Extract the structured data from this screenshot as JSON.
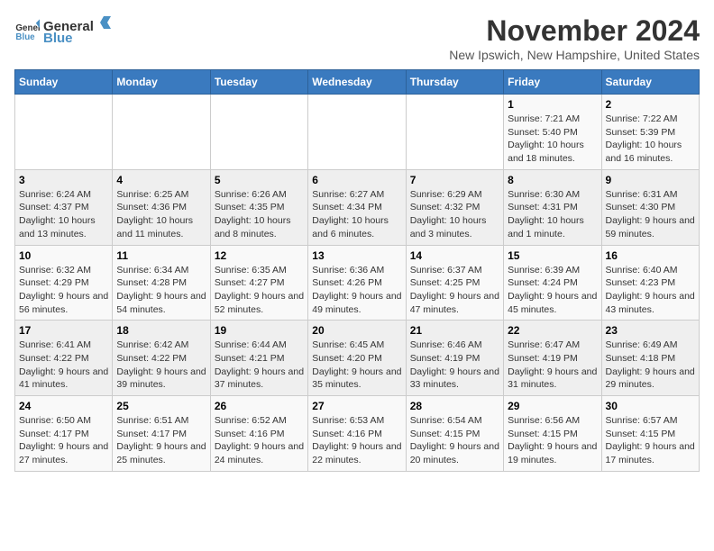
{
  "logo": {
    "text_general": "General",
    "text_blue": "Blue"
  },
  "title": "November 2024",
  "subtitle": "New Ipswich, New Hampshire, United States",
  "days_of_week": [
    "Sunday",
    "Monday",
    "Tuesday",
    "Wednesday",
    "Thursday",
    "Friday",
    "Saturday"
  ],
  "weeks": [
    [
      {
        "day": "",
        "info": ""
      },
      {
        "day": "",
        "info": ""
      },
      {
        "day": "",
        "info": ""
      },
      {
        "day": "",
        "info": ""
      },
      {
        "day": "",
        "info": ""
      },
      {
        "day": "1",
        "info": "Sunrise: 7:21 AM\nSunset: 5:40 PM\nDaylight: 10 hours and 18 minutes."
      },
      {
        "day": "2",
        "info": "Sunrise: 7:22 AM\nSunset: 5:39 PM\nDaylight: 10 hours and 16 minutes."
      }
    ],
    [
      {
        "day": "3",
        "info": "Sunrise: 6:24 AM\nSunset: 4:37 PM\nDaylight: 10 hours and 13 minutes."
      },
      {
        "day": "4",
        "info": "Sunrise: 6:25 AM\nSunset: 4:36 PM\nDaylight: 10 hours and 11 minutes."
      },
      {
        "day": "5",
        "info": "Sunrise: 6:26 AM\nSunset: 4:35 PM\nDaylight: 10 hours and 8 minutes."
      },
      {
        "day": "6",
        "info": "Sunrise: 6:27 AM\nSunset: 4:34 PM\nDaylight: 10 hours and 6 minutes."
      },
      {
        "day": "7",
        "info": "Sunrise: 6:29 AM\nSunset: 4:32 PM\nDaylight: 10 hours and 3 minutes."
      },
      {
        "day": "8",
        "info": "Sunrise: 6:30 AM\nSunset: 4:31 PM\nDaylight: 10 hours and 1 minute."
      },
      {
        "day": "9",
        "info": "Sunrise: 6:31 AM\nSunset: 4:30 PM\nDaylight: 9 hours and 59 minutes."
      }
    ],
    [
      {
        "day": "10",
        "info": "Sunrise: 6:32 AM\nSunset: 4:29 PM\nDaylight: 9 hours and 56 minutes."
      },
      {
        "day": "11",
        "info": "Sunrise: 6:34 AM\nSunset: 4:28 PM\nDaylight: 9 hours and 54 minutes."
      },
      {
        "day": "12",
        "info": "Sunrise: 6:35 AM\nSunset: 4:27 PM\nDaylight: 9 hours and 52 minutes."
      },
      {
        "day": "13",
        "info": "Sunrise: 6:36 AM\nSunset: 4:26 PM\nDaylight: 9 hours and 49 minutes."
      },
      {
        "day": "14",
        "info": "Sunrise: 6:37 AM\nSunset: 4:25 PM\nDaylight: 9 hours and 47 minutes."
      },
      {
        "day": "15",
        "info": "Sunrise: 6:39 AM\nSunset: 4:24 PM\nDaylight: 9 hours and 45 minutes."
      },
      {
        "day": "16",
        "info": "Sunrise: 6:40 AM\nSunset: 4:23 PM\nDaylight: 9 hours and 43 minutes."
      }
    ],
    [
      {
        "day": "17",
        "info": "Sunrise: 6:41 AM\nSunset: 4:22 PM\nDaylight: 9 hours and 41 minutes."
      },
      {
        "day": "18",
        "info": "Sunrise: 6:42 AM\nSunset: 4:22 PM\nDaylight: 9 hours and 39 minutes."
      },
      {
        "day": "19",
        "info": "Sunrise: 6:44 AM\nSunset: 4:21 PM\nDaylight: 9 hours and 37 minutes."
      },
      {
        "day": "20",
        "info": "Sunrise: 6:45 AM\nSunset: 4:20 PM\nDaylight: 9 hours and 35 minutes."
      },
      {
        "day": "21",
        "info": "Sunrise: 6:46 AM\nSunset: 4:19 PM\nDaylight: 9 hours and 33 minutes."
      },
      {
        "day": "22",
        "info": "Sunrise: 6:47 AM\nSunset: 4:19 PM\nDaylight: 9 hours and 31 minutes."
      },
      {
        "day": "23",
        "info": "Sunrise: 6:49 AM\nSunset: 4:18 PM\nDaylight: 9 hours and 29 minutes."
      }
    ],
    [
      {
        "day": "24",
        "info": "Sunrise: 6:50 AM\nSunset: 4:17 PM\nDaylight: 9 hours and 27 minutes."
      },
      {
        "day": "25",
        "info": "Sunrise: 6:51 AM\nSunset: 4:17 PM\nDaylight: 9 hours and 25 minutes."
      },
      {
        "day": "26",
        "info": "Sunrise: 6:52 AM\nSunset: 4:16 PM\nDaylight: 9 hours and 24 minutes."
      },
      {
        "day": "27",
        "info": "Sunrise: 6:53 AM\nSunset: 4:16 PM\nDaylight: 9 hours and 22 minutes."
      },
      {
        "day": "28",
        "info": "Sunrise: 6:54 AM\nSunset: 4:15 PM\nDaylight: 9 hours and 20 minutes."
      },
      {
        "day": "29",
        "info": "Sunrise: 6:56 AM\nSunset: 4:15 PM\nDaylight: 9 hours and 19 minutes."
      },
      {
        "day": "30",
        "info": "Sunrise: 6:57 AM\nSunset: 4:15 PM\nDaylight: 9 hours and 17 minutes."
      }
    ]
  ]
}
